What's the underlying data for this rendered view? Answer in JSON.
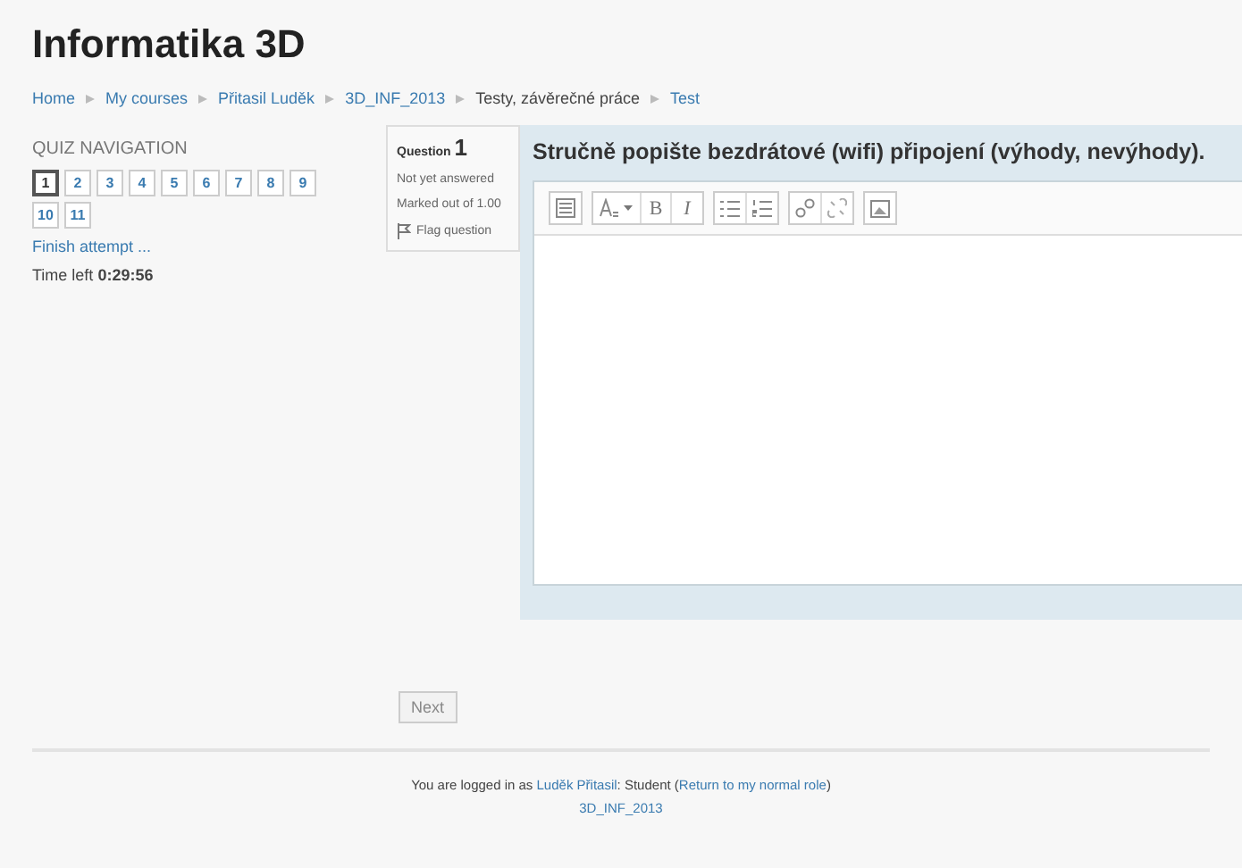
{
  "header": {
    "title": "Informatika 3D"
  },
  "breadcrumb": [
    {
      "label": "Home",
      "link": true
    },
    {
      "label": "My courses",
      "link": true
    },
    {
      "label": "Přitasil Luděk",
      "link": true
    },
    {
      "label": "3D_INF_2013",
      "link": true
    },
    {
      "label": "Testy, závěrečné práce",
      "link": false
    },
    {
      "label": "Test",
      "link": true
    }
  ],
  "quiz_navigation": {
    "heading": "QUIZ NAVIGATION",
    "questions": [
      {
        "label": "1",
        "selected": true
      },
      {
        "label": "2",
        "selected": false
      },
      {
        "label": "3",
        "selected": false
      },
      {
        "label": "4",
        "selected": false
      },
      {
        "label": "5",
        "selected": false
      },
      {
        "label": "6",
        "selected": false
      },
      {
        "label": "7",
        "selected": false
      },
      {
        "label": "8",
        "selected": false
      },
      {
        "label": "9",
        "selected": false
      },
      {
        "label": "10",
        "selected": false
      },
      {
        "label": "11",
        "selected": false
      }
    ],
    "finish_link": "Finish attempt ...",
    "time_label": "Time left",
    "time_value": "0:29:56"
  },
  "question_info": {
    "label": "Question",
    "number": "1",
    "status": "Not yet answered",
    "marks": "Marked out of 1.00",
    "flag": "Flag question"
  },
  "question": {
    "text": "Stručně popište bezdrátové (wifi) připojení (výhody, nevýhody).",
    "toolbar": [
      [
        {
          "kind": "toggle"
        }
      ],
      [
        {
          "kind": "style"
        },
        {
          "kind": "bold",
          "label": "B"
        },
        {
          "kind": "italic",
          "label": "I"
        }
      ],
      [
        {
          "kind": "bullets"
        },
        {
          "kind": "numbers"
        }
      ],
      [
        {
          "kind": "link"
        },
        {
          "kind": "unlink"
        }
      ],
      [
        {
          "kind": "image"
        }
      ]
    ]
  },
  "next_button": "Next",
  "footer": {
    "parts": [
      {
        "text": "You are logged in as ",
        "link": false
      },
      {
        "text": "Luděk Přitasil",
        "link": true
      },
      {
        "text": ": Student (",
        "link": false
      },
      {
        "text": "Return to my normal role",
        "link": true
      },
      {
        "text": ")",
        "link": false
      }
    ],
    "course_link": "3D_INF_2013"
  }
}
